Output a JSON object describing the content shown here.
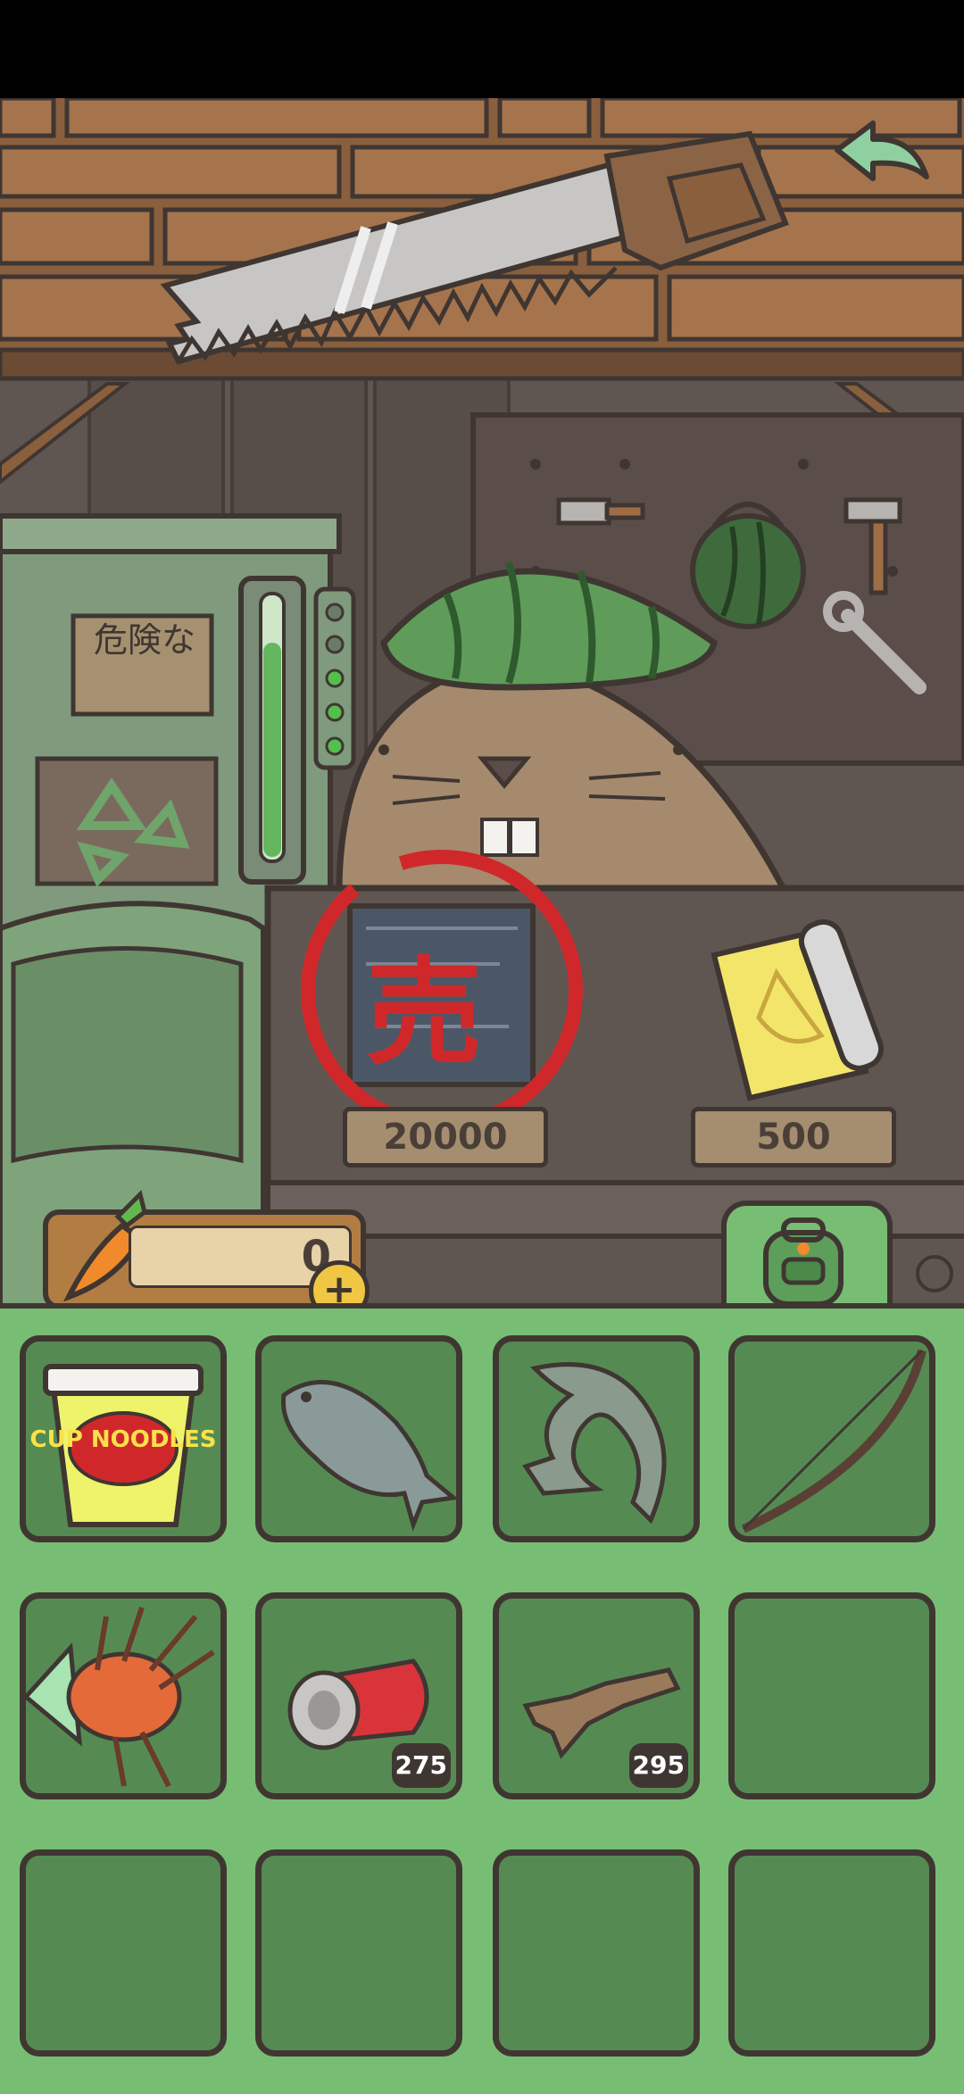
{
  "shop": {
    "items": [
      {
        "name": "blueprint-sold",
        "price": "20000",
        "stamp": "売"
      },
      {
        "name": "banana-blueprint",
        "price": "500"
      }
    ],
    "danger_sign": "危険な"
  },
  "currency": {
    "icon": "carrot-icon",
    "count": "0"
  },
  "inventory": {
    "slots": [
      {
        "item": "cup-noodles",
        "label": "CUP NOODLES",
        "count": ""
      },
      {
        "item": "carp-fish",
        "count": ""
      },
      {
        "item": "sturgeon-fish",
        "count": ""
      },
      {
        "item": "wooden-bow",
        "count": ""
      },
      {
        "item": "lionfish",
        "count": ""
      },
      {
        "item": "crushed-can",
        "count": "275"
      },
      {
        "item": "driftwood-branch",
        "count": "295"
      },
      {
        "item": "empty",
        "count": ""
      },
      {
        "item": "empty",
        "count": ""
      },
      {
        "item": "empty",
        "count": ""
      },
      {
        "item": "empty",
        "count": ""
      },
      {
        "item": "empty",
        "count": ""
      }
    ]
  },
  "colors": {
    "inventory_bg": "#78bd74",
    "slot_bg": "#558b53",
    "outline": "#3f3632",
    "accent_red": "#d0282a"
  }
}
